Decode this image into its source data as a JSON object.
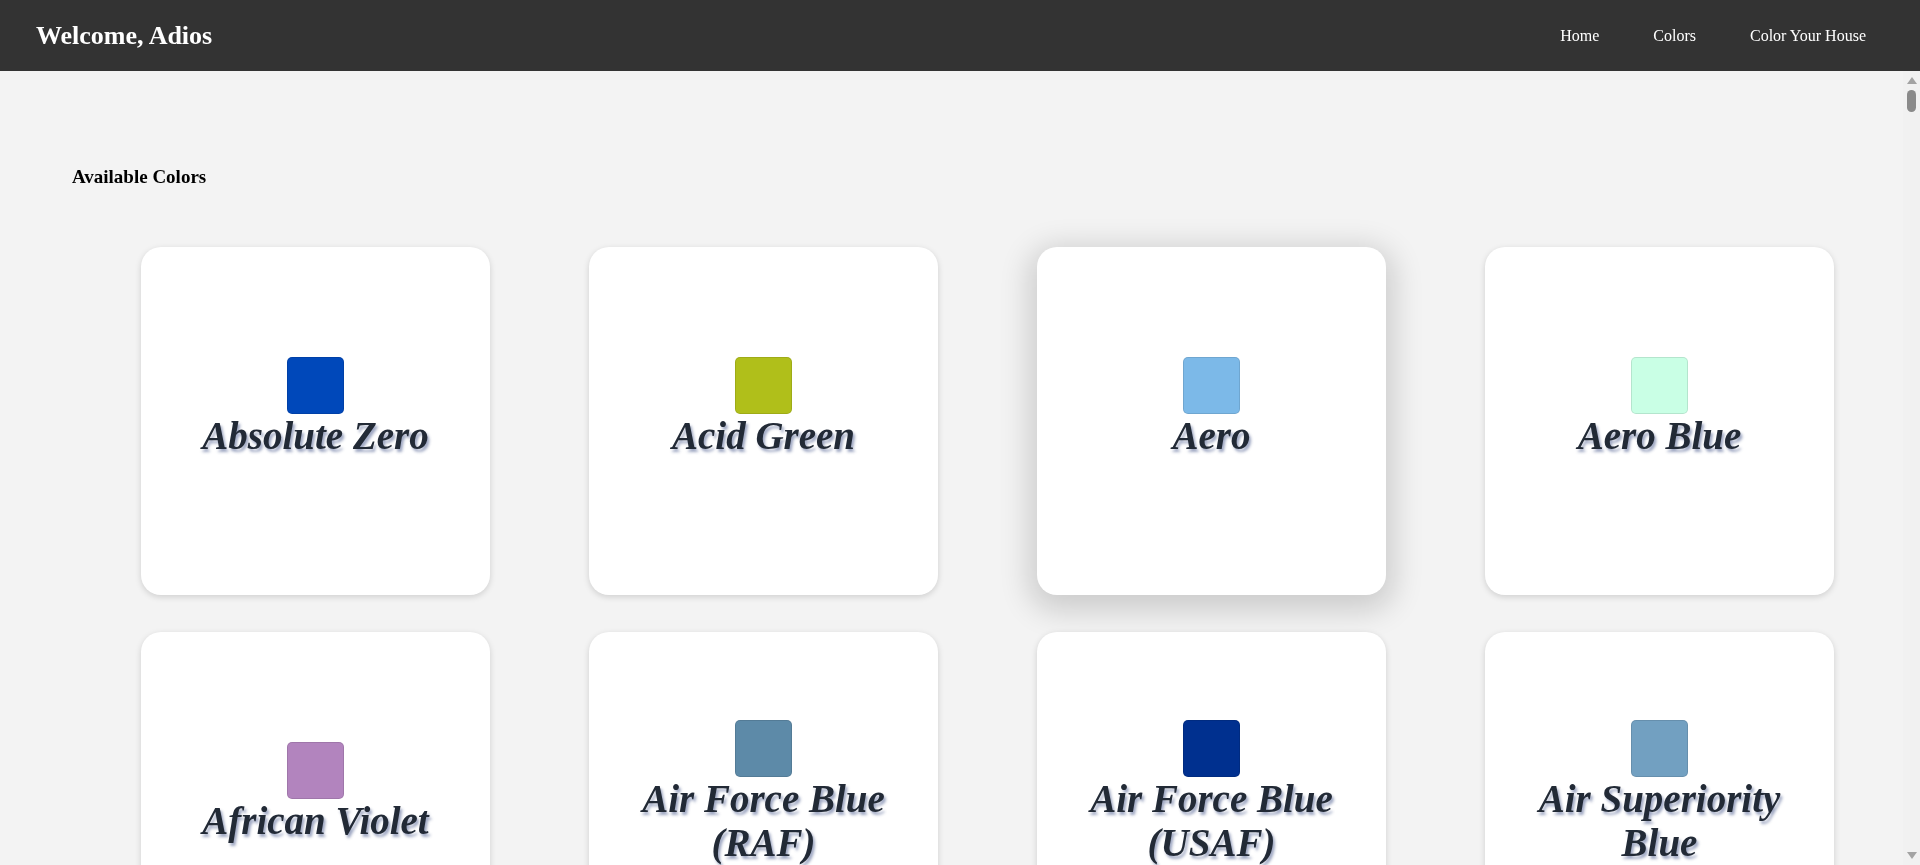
{
  "header": {
    "greeting": "Welcome, Adios",
    "nav": [
      {
        "label": "Home"
      },
      {
        "label": "Colors"
      },
      {
        "label": "Color Your House"
      }
    ]
  },
  "section_title": "Available Colors",
  "colors": [
    {
      "name": "Absolute Zero",
      "color": "#0048ba",
      "hovered": false
    },
    {
      "name": "Acid Green",
      "color": "#b0bf1a",
      "hovered": false
    },
    {
      "name": "Aero",
      "color": "#7cb9e8",
      "hovered": true
    },
    {
      "name": "Aero Blue",
      "color": "#c9ffe5",
      "hovered": false
    },
    {
      "name": "African Violet",
      "color": "#b284be",
      "hovered": false
    },
    {
      "name": "Air Force Blue (RAF)",
      "color": "#5d8aa8",
      "hovered": false
    },
    {
      "name": "Air Force Blue (USAF)",
      "color": "#00308f",
      "hovered": false
    },
    {
      "name": "Air Superiority Blue",
      "color": "#72a0c1",
      "hovered": false
    }
  ]
}
